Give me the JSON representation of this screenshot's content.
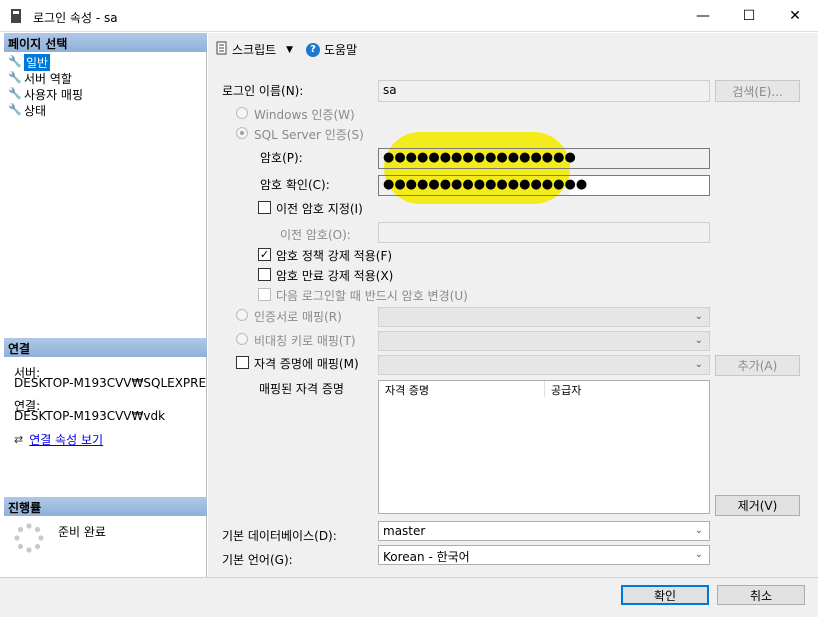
{
  "window": {
    "title": "로그인 속성 - sa",
    "minimize": "—",
    "maximize": "☐",
    "close": "✕"
  },
  "left": {
    "page_select_header": "페이지 선택",
    "pages": [
      "일반",
      "서버 역할",
      "사용자 매핑",
      "상태"
    ],
    "connection_header": "연결",
    "server_label": "서버:",
    "server_value": "DESKTOP-M193CVV₩SQLEXPRE",
    "connection_label": "연결:",
    "connection_value": "DESKTOP-M193CVV₩vdk",
    "view_connection_props": "연결 속성 보기",
    "progress_header": "진행률",
    "progress_status": "준비 완료"
  },
  "toolbar": {
    "script_label": "스크립트",
    "help_label": "도움말"
  },
  "form": {
    "login_name_label": "로그인 이름(N):",
    "login_name_value": "sa",
    "search_button": "검색(E)...",
    "windows_auth": "Windows 인증(W)",
    "sql_auth": "SQL Server 인증(S)",
    "password_label": "암호(P):",
    "password_value": "●●●●●●●●●●●●●●●●●",
    "confirm_label": "암호 확인(C):",
    "confirm_value": "●●●●●●●●●●●●●●●●●●",
    "specify_old_password": "이전 암호 지정(I)",
    "old_password_label": "이전 암호(O):",
    "old_password_value": "",
    "enforce_policy": "암호 정책 강제 적용(F)",
    "enforce_expiration": "암호 만료 강제 적용(X)",
    "must_change": "다음 로그인할 때 반드시 암호 변경(U)",
    "cert_mapped": "인증서로 매핑(R)",
    "asym_key_mapped": "비대칭 키로 매핑(T)",
    "credential_mapped": "자격 증명에 매핑(M)",
    "add_button": "추가(A)",
    "mapped_credentials_label": "매핑된 자격 증명",
    "grid_headers": [
      "자격 증명",
      "공급자"
    ],
    "remove_button": "제거(V)",
    "default_db_label": "기본 데이터베이스(D):",
    "default_db_value": "master",
    "default_lang_label": "기본 언어(G):",
    "default_lang_value": "Korean - 한국어"
  },
  "footer": {
    "ok": "확인",
    "cancel": "취소"
  }
}
